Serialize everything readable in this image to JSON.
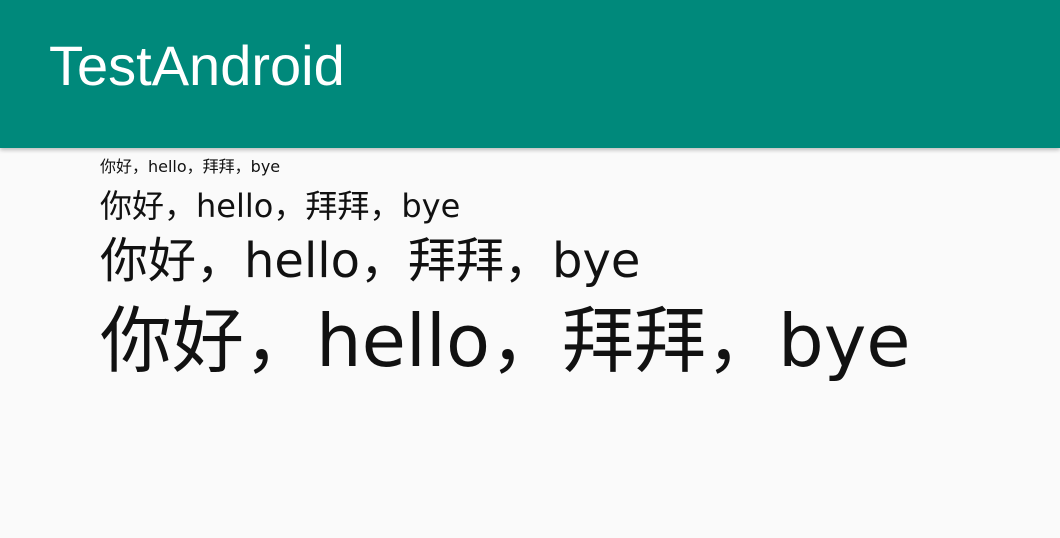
{
  "toolbar": {
    "title": "TestAndroid",
    "background_color": "#00897b"
  },
  "content": {
    "lines": [
      "你好，hello，拜拜，bye",
      "你好，hello，拜拜，bye",
      "你好，hello，拜拜，bye",
      "你好，hello，拜拜，bye"
    ]
  }
}
